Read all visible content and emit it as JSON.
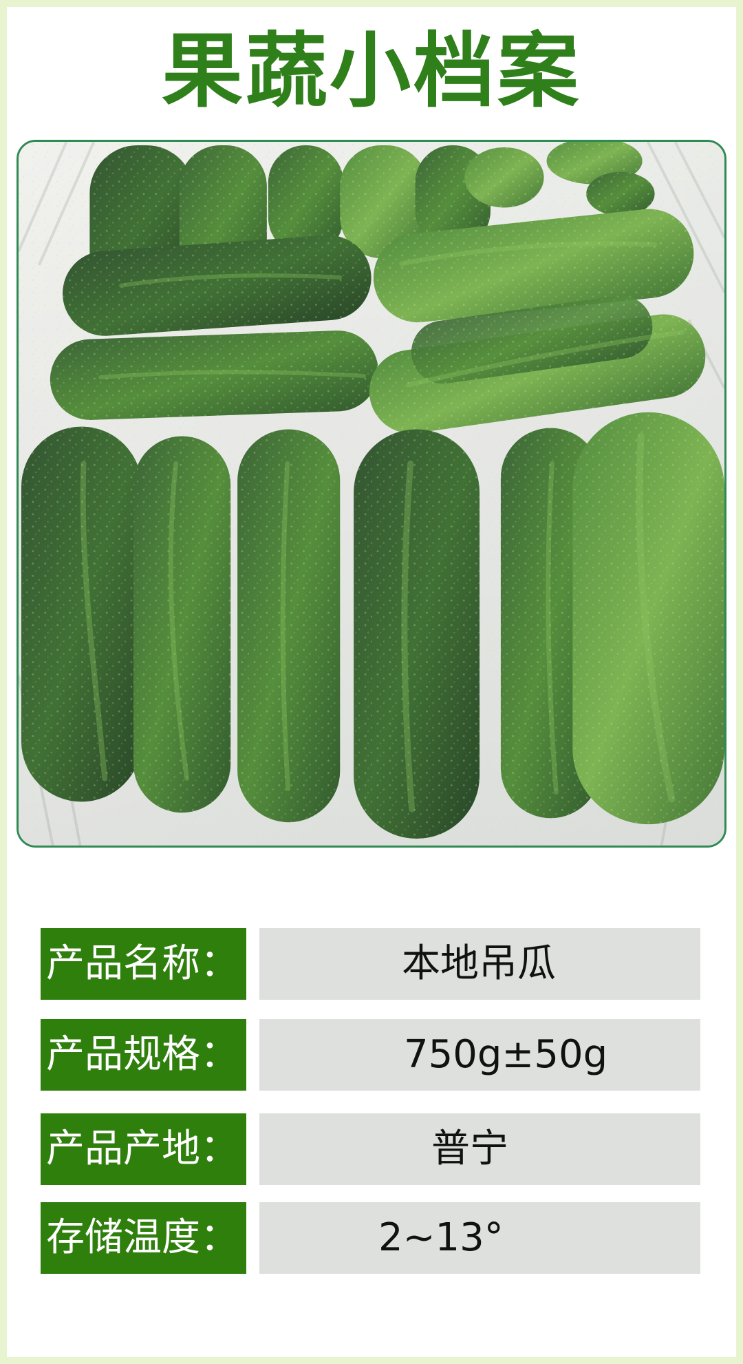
{
  "header": {
    "title": "果蔬小档案"
  },
  "image": {
    "subject": "cucumber-basket-photo"
  },
  "colors": {
    "page_bg": "#e8f4cf",
    "frame_bg": "#ffffff",
    "title": "#2f7f1a",
    "label_bg": "#2f7f0d",
    "value_bg": "#dde0dc",
    "border": "#2f8a54"
  },
  "info": [
    {
      "label": "产品名称：",
      "value": "本地吊瓜"
    },
    {
      "label": "产品规格：",
      "value": "750g±50g"
    },
    {
      "label": "产品产地：",
      "value": "普宁"
    },
    {
      "label": "存储温度：",
      "value": "2~13°"
    }
  ]
}
